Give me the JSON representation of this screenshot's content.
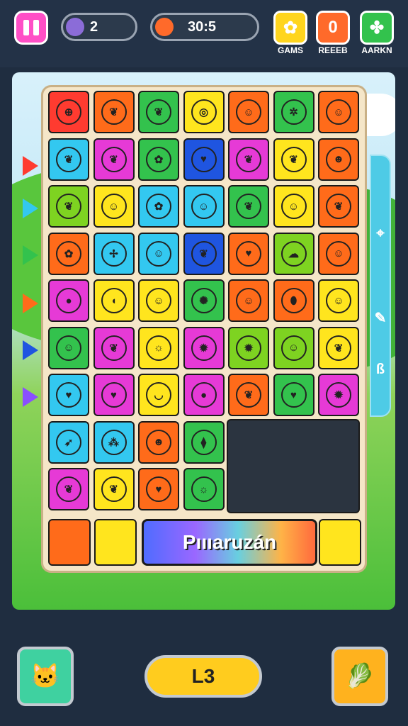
{
  "topbar": {
    "lives_count": "2",
    "score_value": "30:5",
    "buttons": [
      {
        "label": "GAMS",
        "icon": "gear-icon",
        "color": "#ffd51e"
      },
      {
        "label": "REEEB",
        "icon": "zero-badge-icon",
        "color": "#ff6a2a"
      },
      {
        "label": "AARKN",
        "icon": "puzzle-icon",
        "color": "#33c24d"
      }
    ]
  },
  "board": {
    "rows": [
      [
        [
          "#ff3b30",
          "globe-icon"
        ],
        [
          "#ff6b1a",
          "leaf-icon"
        ],
        [
          "#33c24d",
          "leaf-icon"
        ],
        [
          "#ffe51e",
          "shell-icon"
        ],
        [
          "#ff6b1a",
          "frog-icon"
        ],
        [
          "#33c24d",
          "bug-icon"
        ],
        [
          "#ff6b1a",
          "face-icon"
        ]
      ],
      [
        [
          "#33c8f0",
          "leaf-icon"
        ],
        [
          "#e63ad6",
          "leaf-icon"
        ],
        [
          "#33c24d",
          "flower-icon"
        ],
        [
          "#1f55e0",
          "heart-icon"
        ],
        [
          "#e63ad6",
          "leaf-icon"
        ],
        [
          "#ffe51e",
          "leaf-icon"
        ],
        [
          "#ff6b1a",
          "cat-icon"
        ]
      ],
      [
        [
          "#7ed321",
          "leaf-icon"
        ],
        [
          "#ffe51e",
          "face-icon"
        ],
        [
          "#33c8f0",
          "flower-icon"
        ],
        [
          "#33c8f0",
          "face-icon"
        ],
        [
          "#33c24d",
          "leaf-icon"
        ],
        [
          "#ffe51e",
          "face-icon"
        ],
        [
          "#ff6b1a",
          "leaf-icon"
        ]
      ],
      [
        [
          "#ff6b1a",
          "flower-icon"
        ],
        [
          "#33c8f0",
          "sprout-icon"
        ],
        [
          "#33c8f0",
          "face-icon"
        ],
        [
          "#1f55e0",
          "leaf-icon"
        ],
        [
          "#ff6b1a",
          "heart-icon"
        ],
        [
          "#7ed321",
          "cloud-icon"
        ],
        [
          "#ff6b1a",
          "face-icon"
        ]
      ],
      [
        [
          "#e63ad6",
          "ball-icon"
        ],
        [
          "#ffe51e",
          "bean-icon"
        ],
        [
          "#ffe51e",
          "face-icon"
        ],
        [
          "#33c24d",
          "fern-icon"
        ],
        [
          "#ff6b1a",
          "face-icon"
        ],
        [
          "#ff6b1a",
          "egg-icon"
        ],
        [
          "#ffe51e",
          "frog-icon"
        ]
      ],
      [
        [
          "#33c24d",
          "face-icon"
        ],
        [
          "#e63ad6",
          "leaf-icon"
        ],
        [
          "#ffe51e",
          "sun-icon"
        ],
        [
          "#e63ad6",
          "splash-icon"
        ],
        [
          "#7ed321",
          "splash-icon"
        ],
        [
          "#7ed321",
          "face-icon"
        ],
        [
          "#ffe51e",
          "leaf-icon"
        ]
      ],
      [
        [
          "#33c8f0",
          "heart-icon"
        ],
        [
          "#e63ad6",
          "heart-icon"
        ],
        [
          "#ffe51e",
          "banana-icon"
        ],
        [
          "#e63ad6",
          "ball-icon"
        ],
        [
          "#ff6b1a",
          "leaf-icon"
        ],
        [
          "#33c24d",
          "heart-icon"
        ],
        [
          "#e63ad6",
          "splash-icon"
        ]
      ],
      [
        [
          "#33c8f0",
          "bird-icon"
        ],
        [
          "#33c8f0",
          "grape-icon"
        ],
        [
          "#ff6b1a",
          "cat-icon"
        ],
        [
          "#33c24d",
          "carrot-icon"
        ]
      ],
      [
        [
          "#e63ad6",
          "leaf-icon"
        ],
        [
          "#ffe51e",
          "leaf-icon"
        ],
        [
          "#ff6b1a",
          "heart-icon"
        ],
        [
          "#33c24d",
          "sun-icon"
        ]
      ]
    ],
    "bottom_cells": [
      [
        "#ff6b1a"
      ],
      [
        "#ffe51e"
      ],
      [
        "#ffe51e"
      ]
    ],
    "banner_text": "Pıııaruzán"
  },
  "side_arrows": [
    "#ff3b30",
    "#33c8f0",
    "#33c24d",
    "#ff6b1a",
    "#1f55e0",
    "#8a4fff"
  ],
  "side_icons": [
    "map-pin-icon",
    "pencil-icon",
    "b-icon"
  ],
  "footer": {
    "left_icon": "pet-icon",
    "level_label": "L3",
    "right_icon": "card-icon"
  }
}
